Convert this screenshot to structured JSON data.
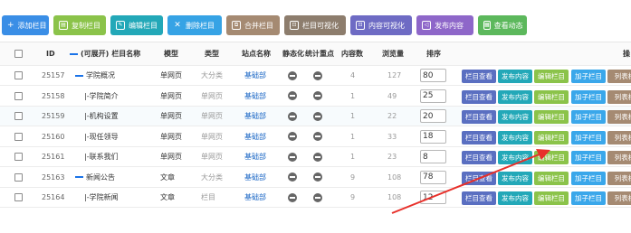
{
  "toolbar": {
    "buttons": [
      {
        "label": "添加栏目",
        "color": "#3a8ee6",
        "icon": "plus-icon"
      },
      {
        "label": "复制栏目",
        "color": "#8bc34a",
        "icon": "copy-icon"
      },
      {
        "label": "编辑栏目",
        "color": "#23a8b8",
        "icon": "edit-icon"
      },
      {
        "label": "删除栏目",
        "color": "#36a3e5",
        "icon": "delete-icon"
      },
      {
        "label": "合并栏目",
        "color": "#a58a72",
        "icon": "merge-icon"
      },
      {
        "label": "栏目可视化",
        "color": "#8d7d6d",
        "icon": "visual-icon"
      },
      {
        "label": "内容可视化",
        "color": "#6e6bc4",
        "icon": "visual-icon"
      },
      {
        "label": "发布内容",
        "color": "#8e67c9",
        "icon": "send-icon"
      },
      {
        "label": "查看动态",
        "color": "#5cb85c",
        "icon": "dynamic-icon"
      }
    ]
  },
  "table": {
    "headers": {
      "id": "ID",
      "expand": "(可展开)",
      "name": "栏目名称",
      "model": "模型",
      "type": "类型",
      "site": "站点名称",
      "static": "静态化",
      "stats": "统计重点",
      "count": "内容数",
      "views": "浏览量",
      "order": "排序",
      "ops": "操"
    },
    "rows": [
      {
        "id": "25157",
        "name": "学院概况",
        "prefix": "bar",
        "model": "单网页",
        "type": "大分类",
        "site": "基础部",
        "count": "4",
        "views": "127",
        "order": "80"
      },
      {
        "id": "25158",
        "name": "|-学院简介",
        "prefix": "",
        "model": "单网页",
        "type": "单网页",
        "site": "基础部",
        "count": "1",
        "views": "49",
        "order": "25"
      },
      {
        "id": "25159",
        "name": "|-机构设置",
        "prefix": "",
        "model": "单网页",
        "type": "单网页",
        "site": "基础部",
        "count": "1",
        "views": "22",
        "order": "20"
      },
      {
        "id": "25160",
        "name": "|-现任领导",
        "prefix": "",
        "model": "单网页",
        "type": "单网页",
        "site": "基础部",
        "count": "1",
        "views": "33",
        "order": "18"
      },
      {
        "id": "25161",
        "name": "|-联系我们",
        "prefix": "",
        "model": "单网页",
        "type": "单网页",
        "site": "基础部",
        "count": "1",
        "views": "23",
        "order": "8"
      },
      {
        "id": "25163",
        "name": "新闻公告",
        "prefix": "bar",
        "model": "文章",
        "type": "大分类",
        "site": "基础部",
        "count": "9",
        "views": "108",
        "order": "78"
      },
      {
        "id": "25164",
        "name": "|-学院新闻",
        "prefix": "",
        "model": "文章",
        "type": "栏目",
        "site": "基础部",
        "count": "9",
        "views": "108",
        "order": "12"
      }
    ],
    "actions": [
      "栏目查看",
      "发布内容",
      "编辑栏目",
      "加子栏目",
      "列表标"
    ]
  },
  "colors": {
    "tree_bar": "#1a73e8",
    "site_link": "#1a66c5",
    "annotation_arrow": "#e8302a"
  }
}
